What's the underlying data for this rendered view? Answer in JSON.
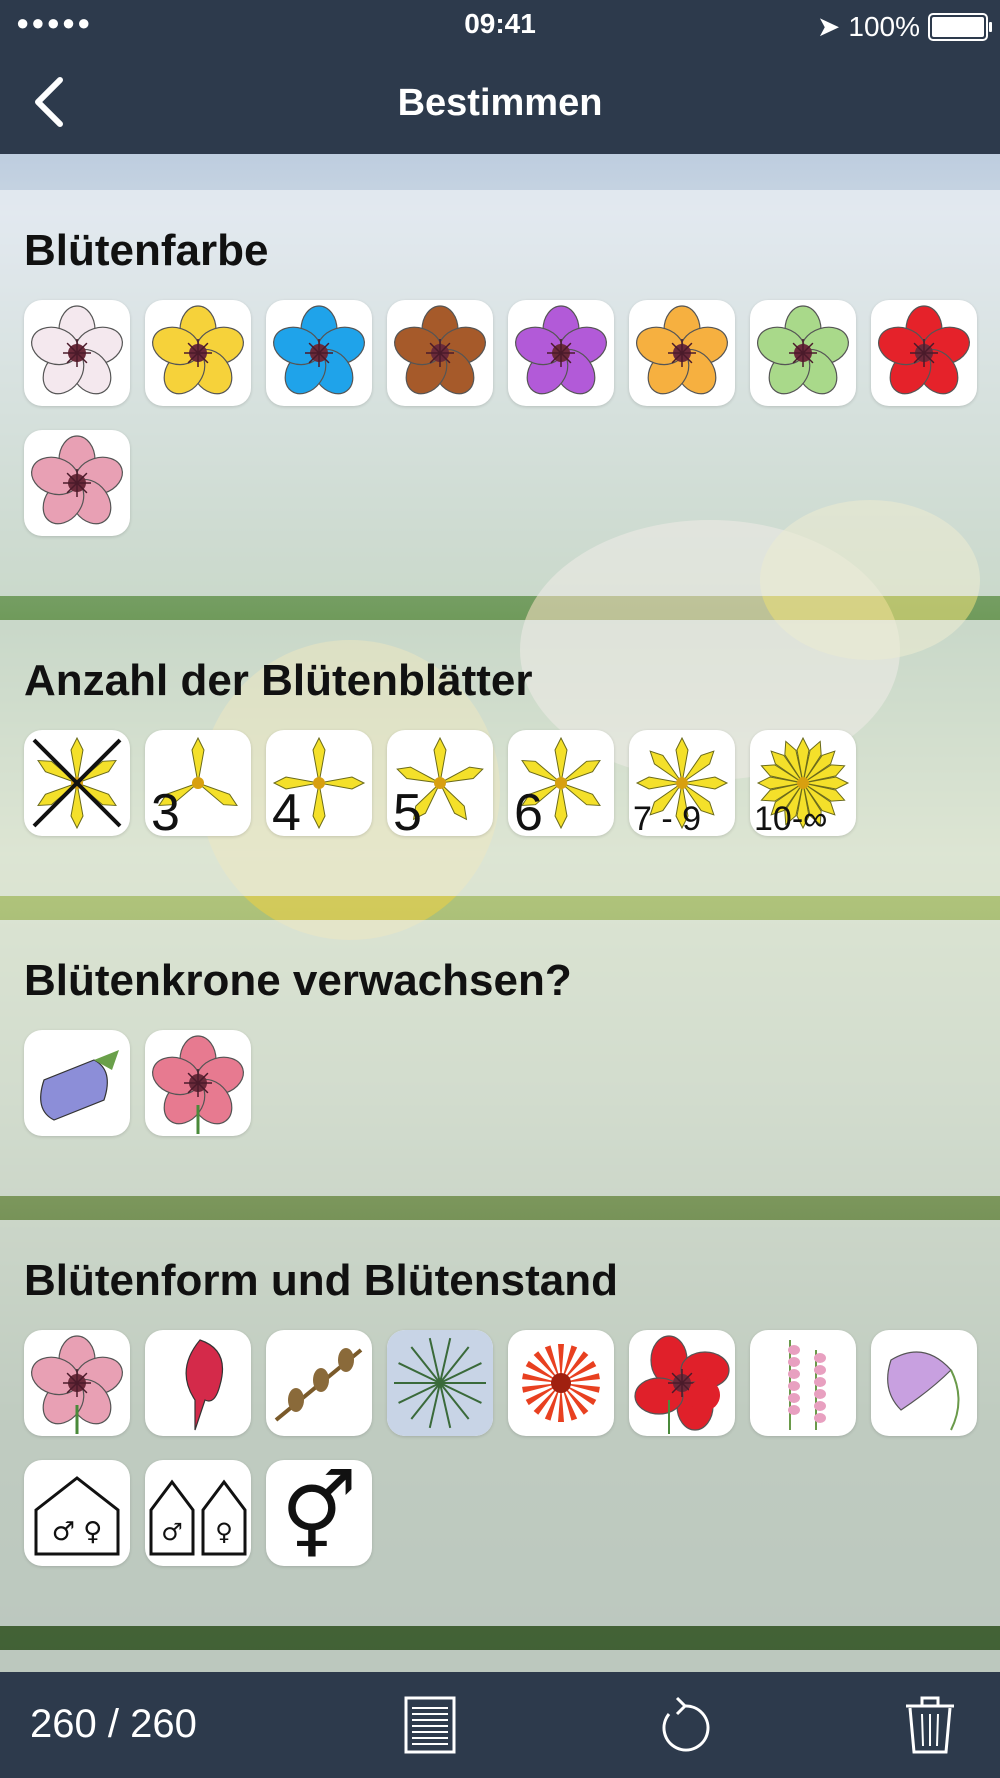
{
  "status_bar": {
    "time": "09:41",
    "battery": "100%",
    "signal": "●●●●●"
  },
  "navbar": {
    "title": "Bestimmen",
    "back_icon": "chevron-left-icon"
  },
  "sections": [
    {
      "title": "Blütenfarbe",
      "options": [
        {
          "name": "white",
          "color": "#f4e8ee"
        },
        {
          "name": "yellow",
          "color": "#f6d23a"
        },
        {
          "name": "blue",
          "color": "#1fa3ea"
        },
        {
          "name": "brown",
          "color": "#a65a2a"
        },
        {
          "name": "purple",
          "color": "#b25ad8"
        },
        {
          "name": "orange",
          "color": "#f6b040"
        },
        {
          "name": "green",
          "color": "#a9d98a"
        },
        {
          "name": "red",
          "color": "#e5222a"
        },
        {
          "name": "pink",
          "color": "#e8a0b4"
        }
      ]
    },
    {
      "title": "Anzahl der Blütenblätter",
      "options": [
        {
          "name": "none",
          "label": ""
        },
        {
          "name": "three",
          "label": "3"
        },
        {
          "name": "four",
          "label": "4"
        },
        {
          "name": "five",
          "label": "5"
        },
        {
          "name": "six",
          "label": "6"
        },
        {
          "name": "seven-nine",
          "label": "7 - 9"
        },
        {
          "name": "ten-plus",
          "label": "10-∞"
        }
      ]
    },
    {
      "title": "Blütenkrone verwachsen?",
      "options": [
        {
          "name": "bell-flower",
          "color": "#8c8ed8"
        },
        {
          "name": "separate-petals",
          "color": "#e77a90"
        }
      ]
    },
    {
      "title": "Blütenform und Blütenstand",
      "options": [
        {
          "name": "single-flower",
          "color": "#e8a0b4"
        },
        {
          "name": "lipped-flower",
          "color": "#d42a4a"
        },
        {
          "name": "catkin",
          "color": "#8a6a3a"
        },
        {
          "name": "umbel",
          "color": "#3a6a3a"
        },
        {
          "name": "composite",
          "color": "#e84020"
        },
        {
          "name": "poppy",
          "color": "#e0202a"
        },
        {
          "name": "spike",
          "color": "#e8a0c0"
        },
        {
          "name": "orchid",
          "color": "#c8a0e0"
        },
        {
          "name": "monoecious",
          "label": "♂ ♀"
        },
        {
          "name": "dioecious",
          "label": "♂|♀"
        },
        {
          "name": "hermaphrodite",
          "label": "⚥"
        }
      ]
    }
  ],
  "toolbar": {
    "count": "260 / 260",
    "list_icon": "list-icon",
    "reset_icon": "reset-icon",
    "trash_icon": "trash-icon"
  }
}
